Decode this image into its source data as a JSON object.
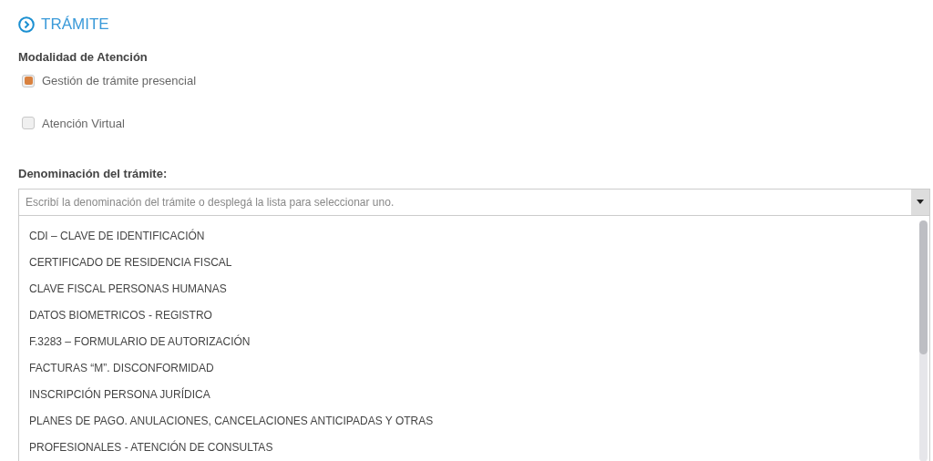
{
  "section": {
    "title": "TRÁMITE"
  },
  "modality": {
    "label": "Modalidad de Atención",
    "options": [
      {
        "label": "Gestión de trámite presencial",
        "checked": true
      },
      {
        "label": "Atención Virtual",
        "checked": false
      }
    ]
  },
  "procedure": {
    "label": "Denominación del trámite:",
    "placeholder": "Escribí la denominación del trámite o desplegá la lista para seleccionar uno.",
    "expanded": true,
    "options": [
      "CDI – CLAVE DE IDENTIFICACIÓN",
      "CERTIFICADO DE RESIDENCIA FISCAL",
      "CLAVE FISCAL PERSONAS HUMANAS",
      "DATOS BIOMETRICOS - REGISTRO",
      "F.3283 – FORMULARIO DE AUTORIZACIÓN",
      "FACTURAS “M”. DISCONFORMIDAD",
      "INSCRIPCIÓN PERSONA JURÍDICA",
      "PLANES DE PAGO. ANULACIONES, CANCELACIONES ANTICIPADAS Y OTRAS",
      "PROFESIONALES - ATENCIÓN DE CONSULTAS"
    ]
  }
}
